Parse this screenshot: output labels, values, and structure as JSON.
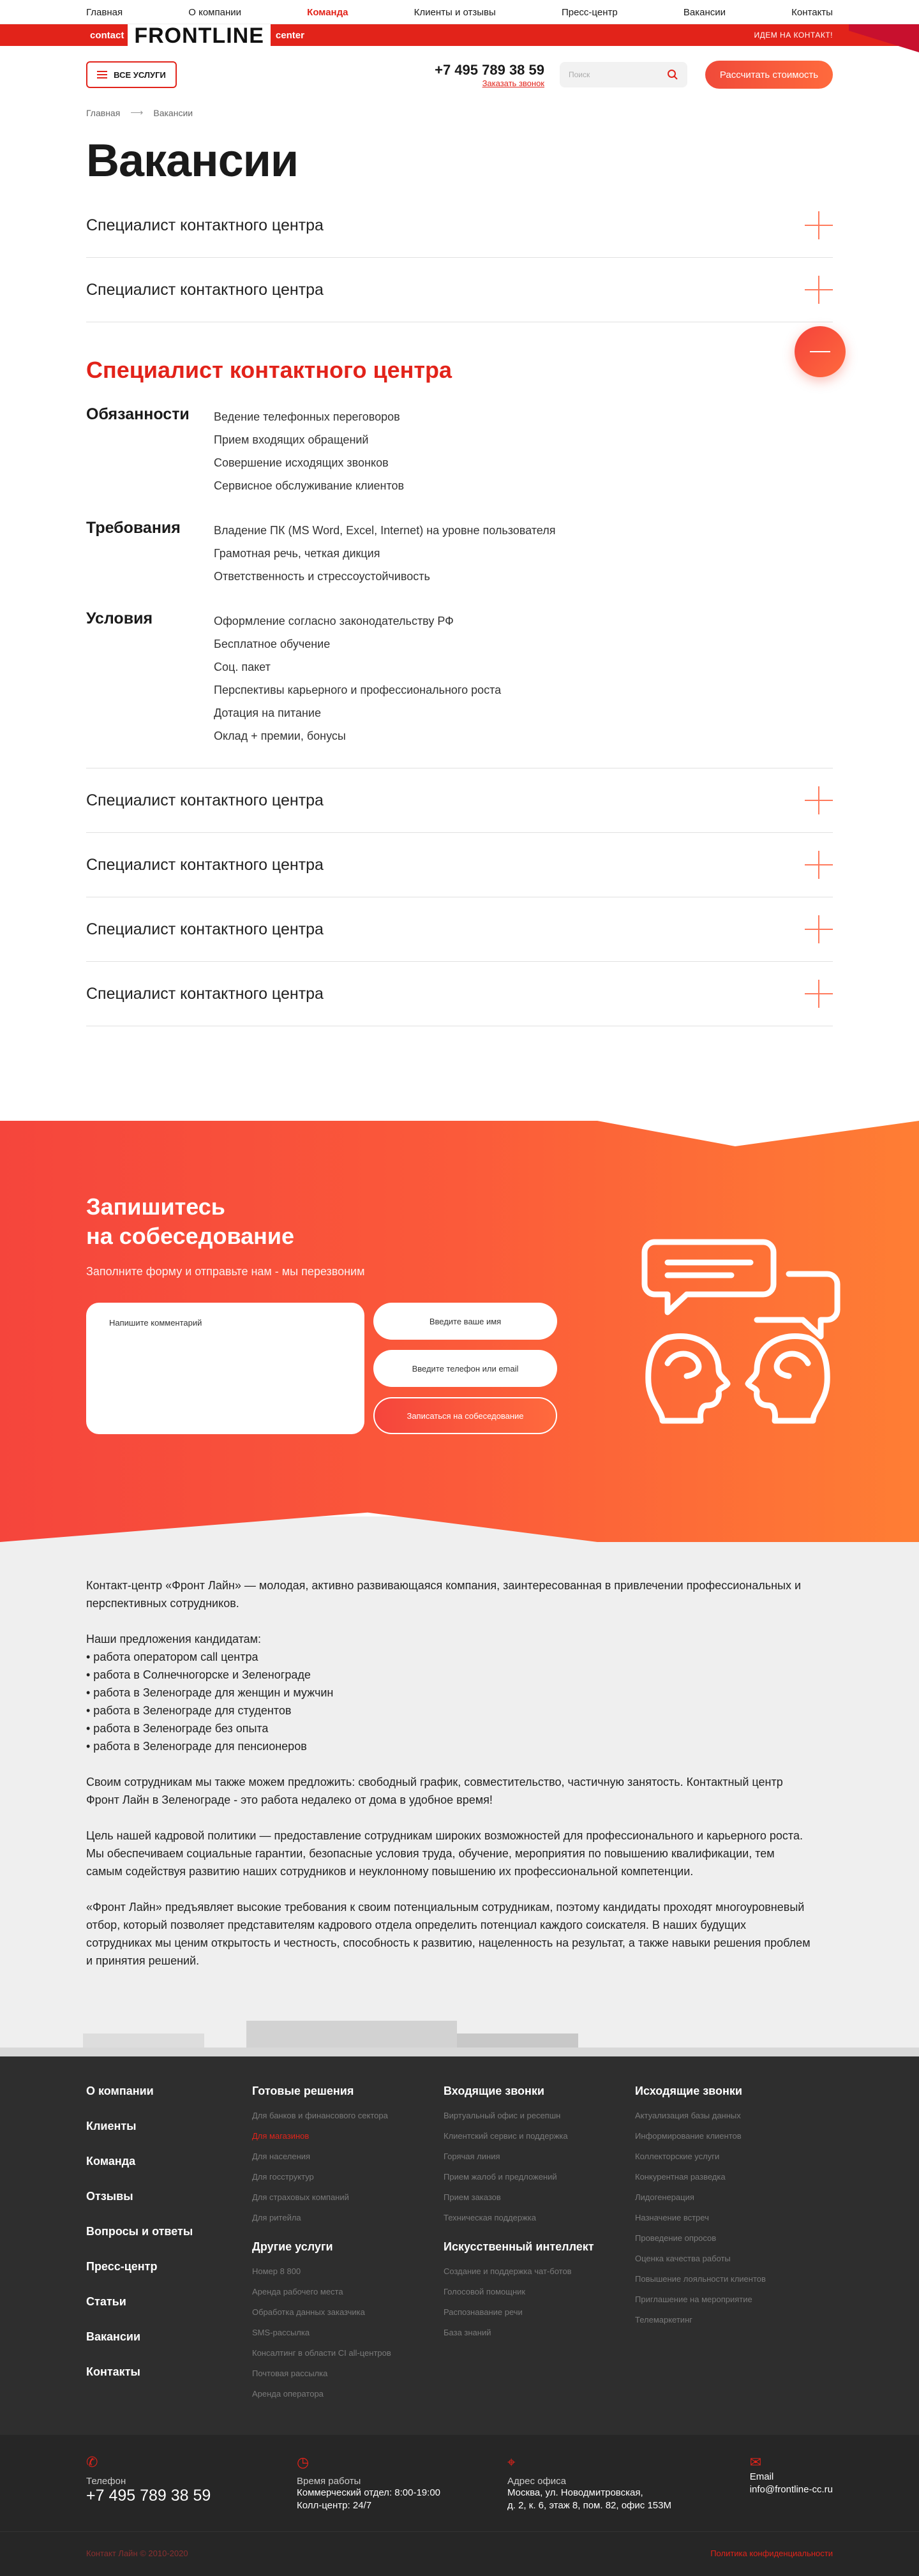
{
  "topnav": {
    "items": [
      "Главная",
      "О компании",
      "Команда",
      "Клиенты и отзывы",
      "Пресс-центр",
      "Вакансии",
      "Контакты"
    ]
  },
  "brand": {
    "contact": "contact",
    "name": "FRONTLINE",
    "center": "center",
    "cta": "ИДЕМ НА КОНТАКТ!"
  },
  "header": {
    "services_label": "ВСЕ УСЛУГИ",
    "phone": "+7 495 789 38 59",
    "callback": "Заказать звонок",
    "search_placeholder": "Поиск",
    "calc_label": "Рассчитать стоимость"
  },
  "breadcrumb": {
    "home": "Главная",
    "current": "Вакансии"
  },
  "page_title": "Вакансии",
  "vacancy_title": "Специалист контактного центра",
  "open_vacancy": {
    "title": "Специалист контактного центра",
    "groups": [
      {
        "label": "Обязанности",
        "items": [
          "Ведение телефонных переговоров",
          "Прием входящих обращений",
          "Совершение исходящих звонков",
          "Сервисное обслуживание клиентов"
        ]
      },
      {
        "label": "Требования",
        "items": [
          "Владение ПК (MS Word, Excel, Internet) на уровне пользователя",
          "Грамотная речь, четкая дикция",
          "Ответственность и стрессоустойчивость"
        ]
      },
      {
        "label": "Условия",
        "items": [
          "Оформление согласно законодательству РФ",
          "Бесплатное обучение",
          "Соц. пакет",
          "Перспективы карьерного и профессионального роста",
          "Дотация на питание",
          "Оклад + премии, бонусы"
        ]
      }
    ]
  },
  "signup": {
    "title_line1": "Запишитесь",
    "title_line2": "на собеседование",
    "subtitle": "Заполните форму и отправьте нам - мы перезвоним",
    "comment_placeholder": "Напишите комментарий",
    "name_placeholder": "Введите ваше имя",
    "phone_placeholder": "Введите телефон или email",
    "submit_label": "Записаться на собеседование"
  },
  "about": {
    "p1": "Контакт-центр «Фронт Лайн» — молодая, активно развивающаяся компания, заинтересованная в привлечении профессиональных и перспективных сотрудников.",
    "offers_title": "Наши предложения кандидатам:",
    "offers": [
      "• работа оператором call центра",
      "• работа в Солнечногорске и Зеленограде",
      "• работа в Зеленограде для женщин и мужчин",
      "• работа в Зеленограде для студентов",
      "• работа в Зеленограде без опыта",
      "• работа в Зеленограде для пенсионеров"
    ],
    "p2": "Своим сотрудникам мы также можем предложить: свободный график, совместительство, частичную занятость. Контактный центр Фронт Лайн в Зеленограде - это работа недалеко от дома в удобное время!",
    "p3": "Цель нашей кадровой политики — предоставление сотрудникам широких возможностей для профессионального и карьерного роста. Мы обеспечиваем социальные гарантии, безопасные условия труда, обучение, мероприятия по повышению квалификации, тем самым содействуя развитию наших сотрудников и неуклонному повышению их профессиональной компетенции.",
    "p4": "«Фронт Лайн» предъявляет высокие требования к своим потенциальным сотрудникам, поэтому кандидаты проходят многоуровневый отбор, который позволяет представителям кадрового отдела определить потенциал каждого соискателя. В наших будущих сотрудниках мы ценим открытость и честность, способность к развитию, нацеленность на результат, а также навыки решения проблем и принятия решений."
  },
  "footer": {
    "main_links": [
      "О компании",
      "Клиенты",
      "Команда",
      "Отзывы",
      "Вопросы и ответы",
      "Пресс-центр",
      "Статьи",
      "Вакансии",
      "Контакты"
    ],
    "ready": {
      "title": "Готовые решения",
      "items": [
        "Для банков и финансового сектора",
        "Для магазинов",
        "Для населения",
        "Для госструктур",
        "Для страховых компаний",
        "Для ритейла"
      ]
    },
    "other": {
      "title": "Другие услуги",
      "items": [
        "Номер 8 800",
        "Аренда рабочего места",
        "Обработка данных заказчика",
        "SMS-рассылка",
        "Консалтинг в области CI all-центров",
        "Почтовая рассылка",
        "Аренда оператора"
      ]
    },
    "incoming": {
      "title": "Входящие звонки",
      "items": [
        "Виртуальный офис и ресепшн",
        "Клиентский сервис и поддержка",
        "Горячая линия",
        "Прием жалоб и предложений",
        "Прием заказов",
        "Техническая поддержка"
      ]
    },
    "ai": {
      "title": "Искусственный интеллект",
      "items": [
        "Создание и поддержка чат-ботов",
        "Голосовой помощник",
        "Распознавание речи",
        "База знаний"
      ]
    },
    "outgoing": {
      "title": "Исходящие звонки",
      "items": [
        "Актуализация базы данных",
        "Информирование клиентов",
        "Коллекторские услуги",
        "Конкурентная разведка",
        "Лидогенерация",
        "Назначение встреч",
        "Проведение опросов",
        "Оценка качества работы",
        "Повышение лояльности клиентов",
        "Приглашение на мероприятие",
        "Телемаркетинг"
      ]
    }
  },
  "contacts": {
    "phone_label": "Телефон",
    "phone": "+7 495 789 38 59",
    "hours_label": "Время работы",
    "hours_1": "Коммерческий отдел: 8:00-19:00",
    "hours_2": "Колл-центр: 24/7",
    "address_label": "Адрес офиса",
    "address_1": "Москва, ул. Новодмитровская,",
    "address_2": "д. 2, к. 6, этаж 8, пом. 82, офис 153М",
    "email_label": "Email",
    "email": "info@frontline-cc.ru"
  },
  "bottom": {
    "copyright": "Контакт Лайн © 2010-2020",
    "policy": "Политика конфиденциальности"
  },
  "colors": {
    "accent": "#e2231a",
    "gradient_end": "#ff7e34",
    "footer_bg": "#2e2e2e"
  }
}
